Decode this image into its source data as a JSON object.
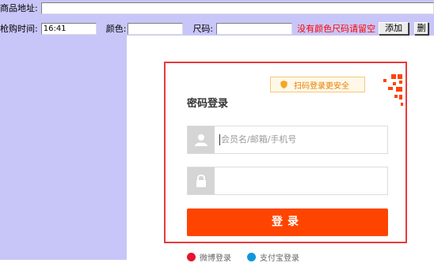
{
  "toolbar": {
    "product_url_label": "商品地址:",
    "product_url_value": "",
    "rush_time_label": "枪购时间:",
    "rush_time_value": "16:41",
    "color_label": "颜色:",
    "color_value": "",
    "size_label": "尺码:",
    "size_value": "",
    "hint_text": "没有颜色尺码请留空",
    "add_button": "添加",
    "delete_button": "删"
  },
  "login": {
    "title": "密码登录",
    "qr_tip": "扫码登录更安全",
    "username_placeholder": "会员名/邮箱/手机号",
    "password_placeholder": "",
    "submit_label": "登录",
    "weibo_label": "微博登录",
    "alipay_label": "支付宝登录"
  },
  "colors": {
    "app_background": "#c8c6f8",
    "highlight_border": "#e83a3a",
    "login_button": "#ff4400",
    "hint_text": "#ff0000",
    "qr_tip_text": "#e67e00"
  },
  "icons": [
    "user-icon",
    "lock-icon",
    "shield-icon",
    "qr-code-icon",
    "weibo-icon",
    "alipay-icon"
  ]
}
